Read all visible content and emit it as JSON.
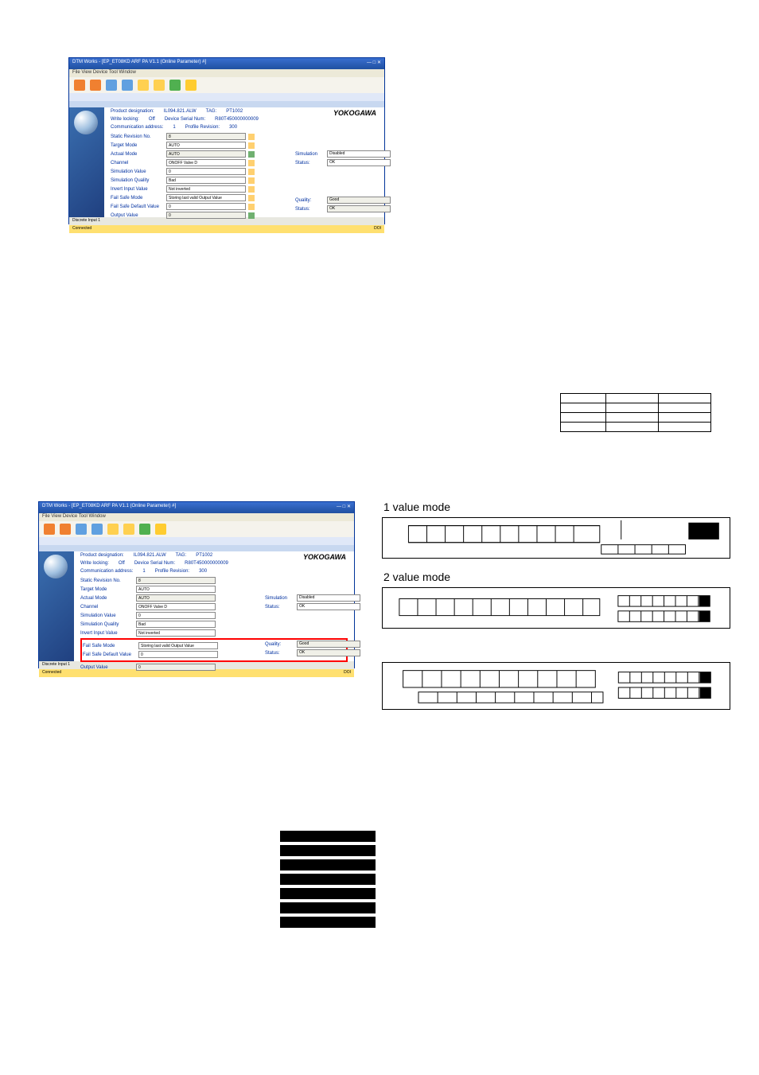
{
  "window": {
    "title": "DTM Works - [EP_ET08KD ARF PA V1.1 (Online Parameter) #]",
    "menus": "File  View  Device  Tool  Window"
  },
  "device": {
    "product_designation_label": "Product designation:",
    "product_designation": "IL094.821.ALW",
    "tag_label": "TAG:",
    "tag": "PT1002",
    "write_lock_label": "Write locking:",
    "write_lock": "Off",
    "serial_label": "Device Serial Num:",
    "serial": "R80T450000000009",
    "comm_addr_label": "Communication address:",
    "comm_addr": "1",
    "profile_rev_label": "Profile Revision:",
    "profile_rev": "300"
  },
  "params": {
    "static_rev_label": "Static Revision No.",
    "static_rev": "8",
    "target_mode_label": "Target Mode",
    "target_mode": "AUTO",
    "actual_mode_label": "Actual Mode",
    "actual_mode": "AUTO",
    "channel_label": "Channel",
    "channel": "ONOFF Valve D",
    "sim_value_label": "Simulation Value",
    "sim_value": "0",
    "sim_quality_label": "Simulation Quality",
    "sim_quality": "Bad",
    "invert_label": "Invert Input Value",
    "invert": "Not inverted",
    "fail_safe_mode_label": "Fail Safe Mode",
    "fail_safe_mode": "Storing last valid Output Value",
    "fail_safe_default_label": "Fail Safe Default Value",
    "fail_safe_default": "0",
    "output_value_label": "Output Value",
    "output_value": "0"
  },
  "right": {
    "simulation_label": "Simulation",
    "simulation": "Disabled",
    "status_label": "Status:",
    "status": "OK",
    "quality_label": "Quality:",
    "quality": "Good",
    "out_status_label": "Status:",
    "out_status": "OK"
  },
  "brand": "YOKOGAWA",
  "block_label": "Discrete Input 1",
  "conn_status": "Connected",
  "status_label_bottom": "DOI",
  "value_mode_1": "1 value mode",
  "value_mode_2": "2 value mode",
  "chart_data": {
    "type": "bar",
    "note": "Horizontal filled-bar indicator stack (7 rows), each row fully filled black, equal length.",
    "rows": 7,
    "fill_fraction": [
      1,
      1,
      1,
      1,
      1,
      1,
      1
    ]
  }
}
